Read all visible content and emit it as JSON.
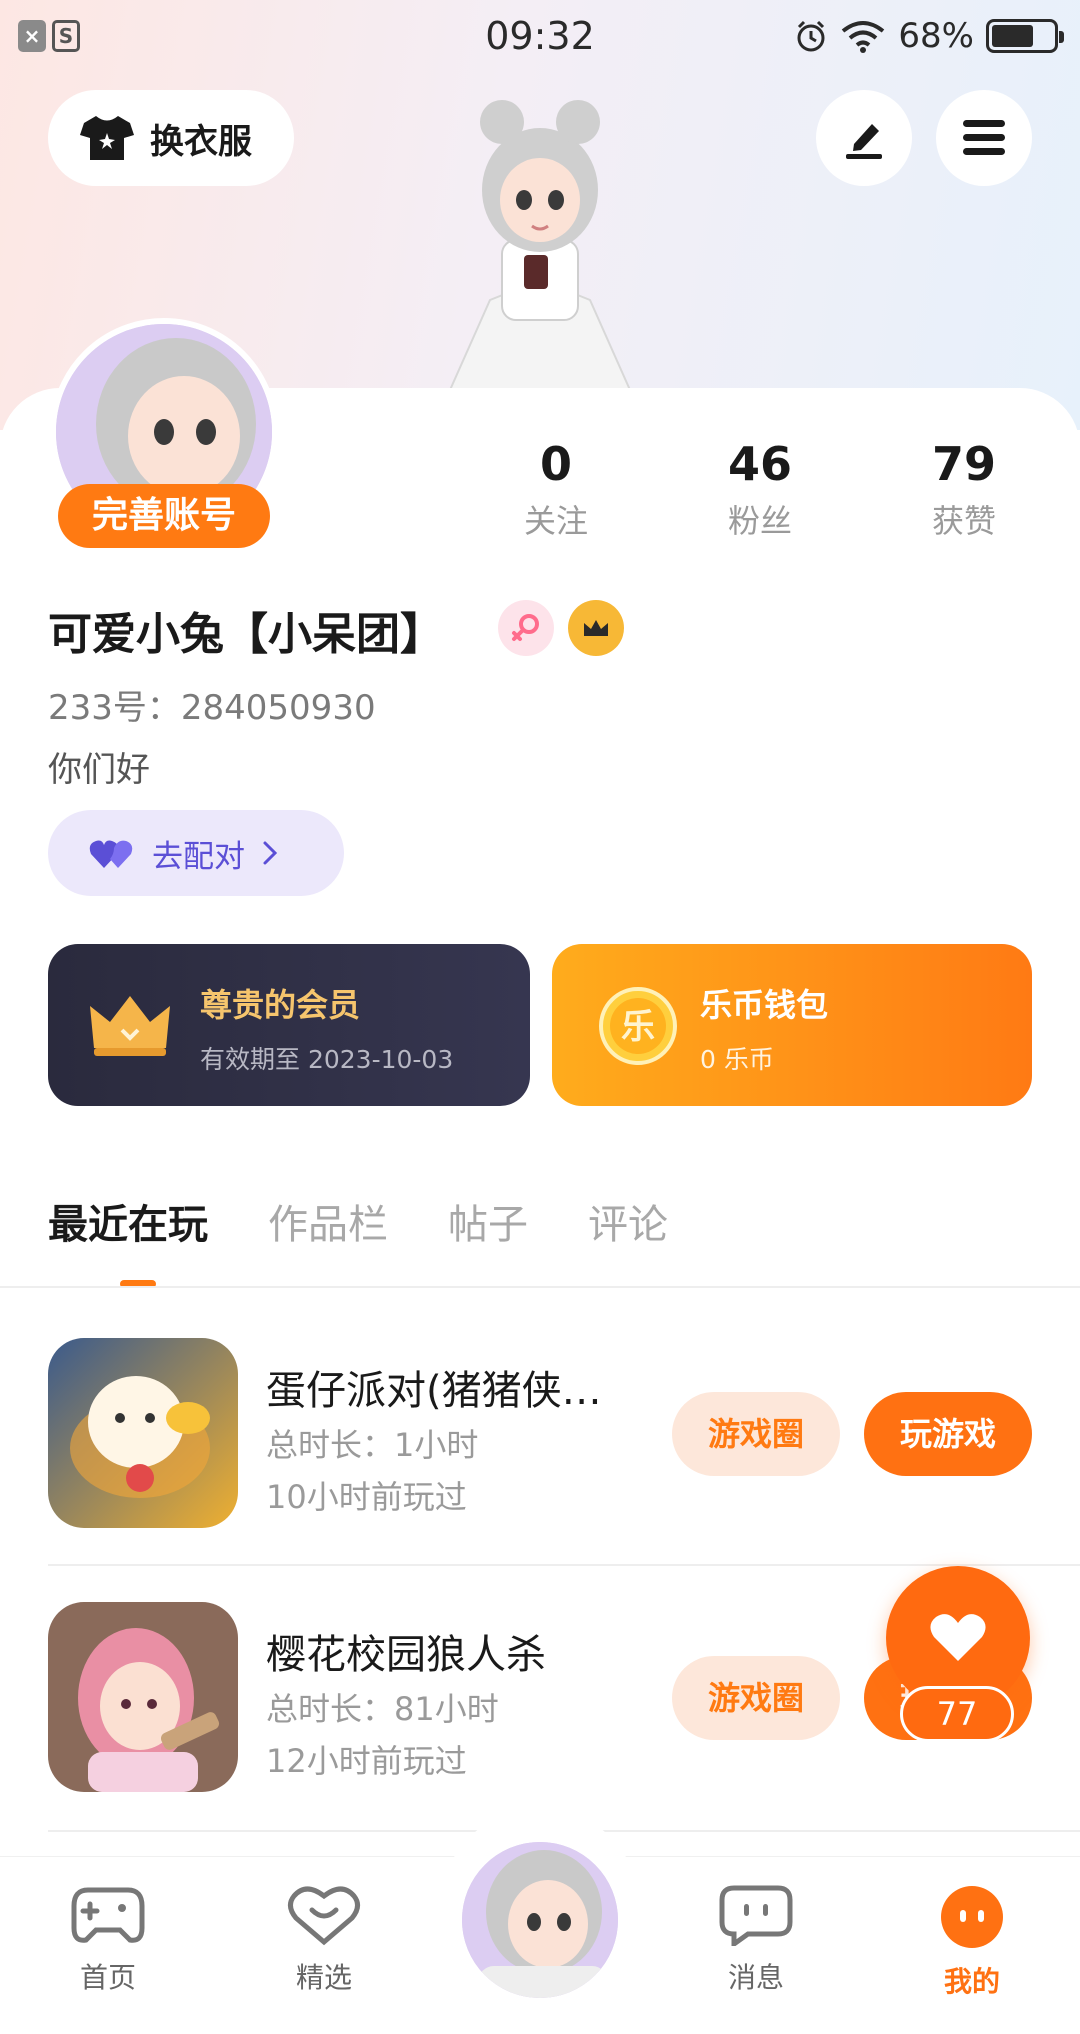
{
  "status_bar": {
    "time": "09:32",
    "battery": "68%",
    "battery_level": 0.68
  },
  "header": {
    "dress_label": "换衣服",
    "edit_icon": "pen-icon",
    "menu_icon": "menu-icon"
  },
  "profile": {
    "complete_label": "完善账号",
    "stats": [
      {
        "value": "0",
        "label": "关注"
      },
      {
        "value": "46",
        "label": "粉丝"
      },
      {
        "value": "79",
        "label": "获赞"
      }
    ],
    "nickname": "可爱小兔【小呆团】",
    "uid": "233号：284050930",
    "bio": "你们好",
    "match_label": "去配对"
  },
  "cards": {
    "vip": {
      "title": "尊贵的会员",
      "sub": "有效期至 2023-10-03"
    },
    "wallet": {
      "title": "乐币钱包",
      "sub": "0 乐币",
      "coin_char": "乐"
    }
  },
  "tabs": [
    "最近在玩",
    "作品栏",
    "帖子",
    "评论"
  ],
  "games": [
    {
      "name": "蛋仔派对(猪猪侠…",
      "duration": "总时长：1小时",
      "last": "10小时前玩过",
      "circle": "游戏圈",
      "play": "玩游戏"
    },
    {
      "name": "樱花校园狼人杀",
      "duration": "总时长：81小时",
      "last": "12小时前玩过",
      "circle": "游戏圈",
      "play": "玩游戏"
    }
  ],
  "like": {
    "count": "77"
  },
  "nav": [
    {
      "label": "首页",
      "icon": "gamepad-icon"
    },
    {
      "label": "精选",
      "icon": "heart-chat-icon"
    },
    {
      "label": "消息",
      "icon": "message-icon"
    },
    {
      "label": "我的",
      "icon": "smile-icon"
    }
  ],
  "colors": {
    "accent": "#ff7112",
    "vip_gold": "#f6c56d",
    "match_purple": "#5b4fd6"
  }
}
